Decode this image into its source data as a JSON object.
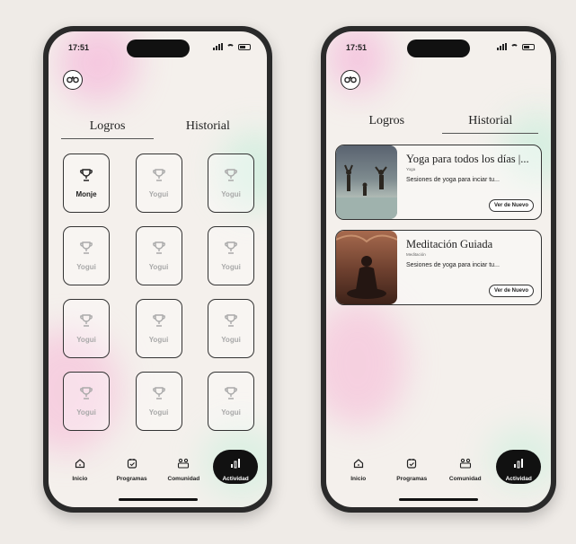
{
  "status_bar": {
    "time_left": "17:51",
    "time_right": "17:51"
  },
  "logros_screen": {
    "tabs": [
      {
        "label": "Logros",
        "active": true
      },
      {
        "label": "Historial",
        "active": false
      }
    ],
    "badges": [
      {
        "label": "Monje",
        "unlocked": true
      },
      {
        "label": "Yogui",
        "unlocked": false
      },
      {
        "label": "Yogui",
        "unlocked": false
      },
      {
        "label": "Yogui",
        "unlocked": false
      },
      {
        "label": "Yogui",
        "unlocked": false
      },
      {
        "label": "Yogui",
        "unlocked": false
      },
      {
        "label": "Yogui",
        "unlocked": false
      },
      {
        "label": "Yogui",
        "unlocked": false
      },
      {
        "label": "Yogui",
        "unlocked": false
      },
      {
        "label": "Yogui",
        "unlocked": false
      },
      {
        "label": "Yogui",
        "unlocked": false
      },
      {
        "label": "Yogui",
        "unlocked": false
      }
    ]
  },
  "historial_screen": {
    "tabs": [
      {
        "label": "Logros",
        "active": false
      },
      {
        "label": "Historial",
        "active": true
      }
    ],
    "cards": [
      {
        "title": "Yoga para todos los días |...",
        "category": "Yoga",
        "description": "Sesiones de yoga para inciar tu...",
        "button": "Ver de Nuevo"
      },
      {
        "title": "Meditación Guiada",
        "category": "Meditación",
        "description": "Sesiones de yoga para inciar tu...",
        "button": "Ver de Nuevo"
      }
    ]
  },
  "nav": [
    {
      "label": "Inicio",
      "icon": "home-icon"
    },
    {
      "label": "Programas",
      "icon": "calendar-icon"
    },
    {
      "label": "Comunidad",
      "icon": "community-icon"
    },
    {
      "label": "Actividad",
      "icon": "activity-chart-icon",
      "active": true
    }
  ],
  "colors": {
    "background": "#efebe7",
    "screen": "#f4f0ec",
    "accent_dark": "#111111",
    "muted_label": "#a9a9a9"
  }
}
